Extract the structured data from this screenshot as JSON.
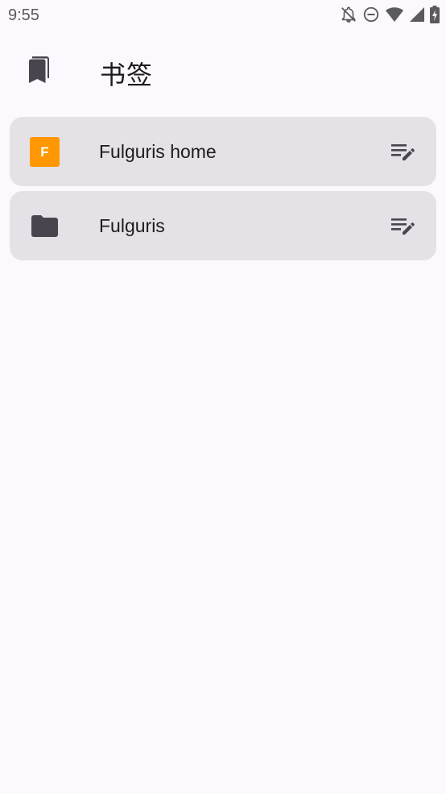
{
  "status_bar": {
    "time": "9:55",
    "icons": [
      "notifications-off-icon",
      "do-not-disturb-icon",
      "wifi-icon",
      "signal-icon",
      "battery-charging-icon"
    ]
  },
  "header": {
    "icon": "bookmarks-icon",
    "title": "书签"
  },
  "bookmarks": [
    {
      "type": "bookmark",
      "favicon_letter": "F",
      "favicon_color": "#ff9800",
      "label": "Fulguris home",
      "action_icon": "edit-list-icon"
    },
    {
      "type": "folder",
      "icon": "folder-icon",
      "label": "Fulguris",
      "action_icon": "edit-list-icon"
    }
  ],
  "colors": {
    "background": "#fcf8fd",
    "item_background": "#e6e1e6",
    "icon_dark": "#49454f",
    "accent": "#ff9800"
  }
}
